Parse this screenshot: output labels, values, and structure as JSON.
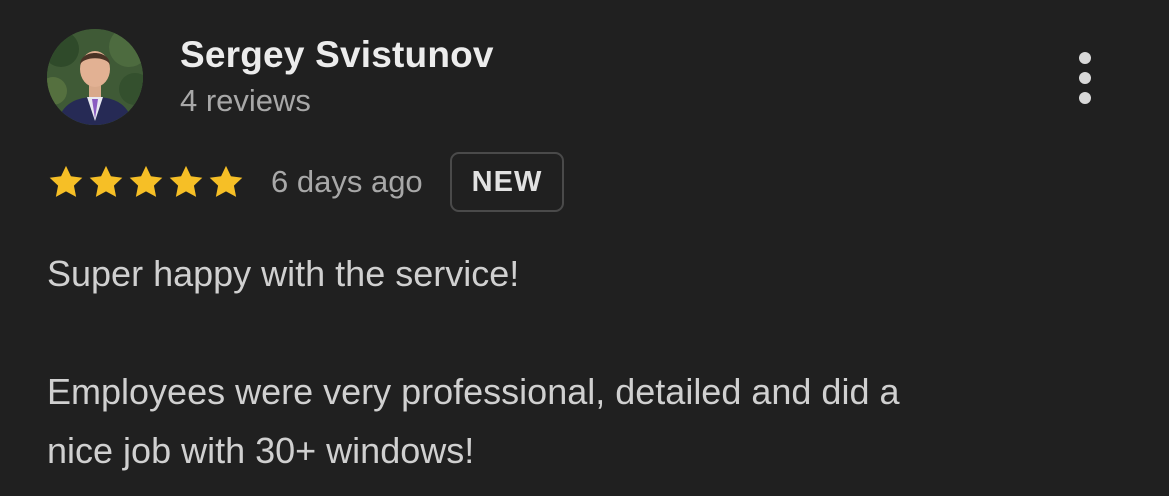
{
  "review": {
    "author_name": "Sergey Svistunov",
    "review_count": "4 reviews",
    "rating": 5,
    "rating_max": 5,
    "date": "6 days ago",
    "badge": "NEW",
    "text_paragraph_1": "Super happy with the service!",
    "text_paragraph_2_line_1": "Employees were very professional, detailed and did a",
    "text_paragraph_2_line_2": "nice job with 30+ windows!"
  },
  "icons": {
    "star": "star-icon",
    "more": "more-vertical-icon"
  },
  "colors": {
    "background": "#202020",
    "star": "#f6bf26",
    "name": "#ececec",
    "secondary_text": "#a8a8a8",
    "body_text": "#d0d0d0",
    "badge_border": "#4a4a4a"
  }
}
